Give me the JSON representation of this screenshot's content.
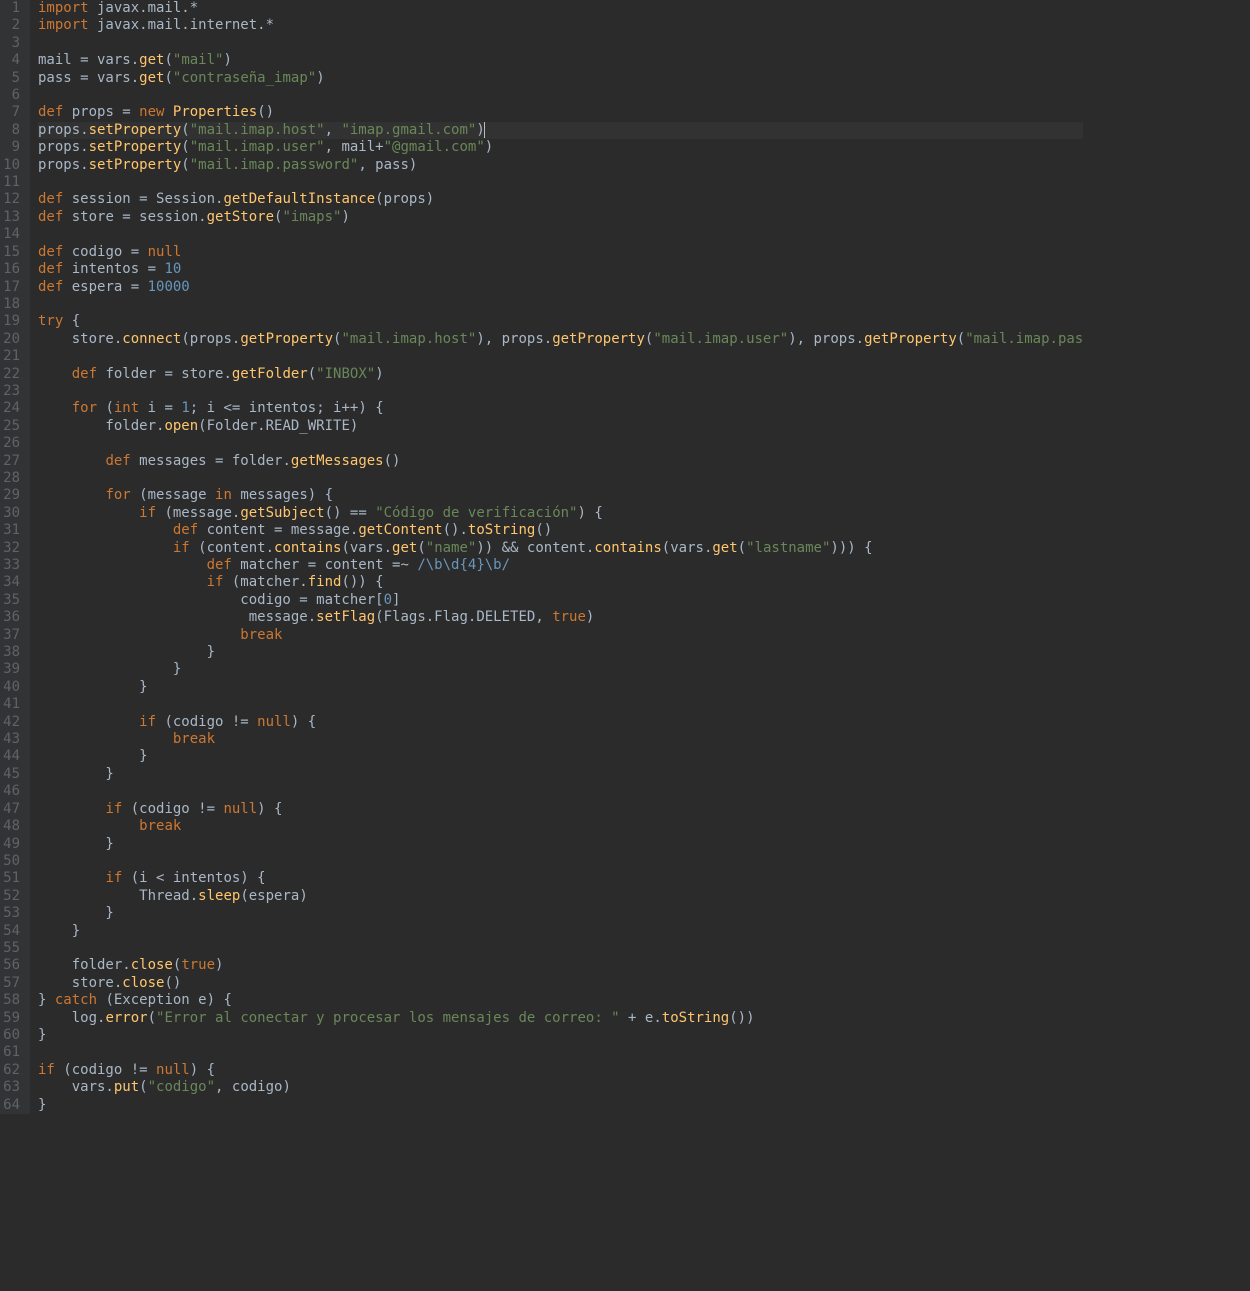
{
  "colors": {
    "bg": "#2b2b2b",
    "gutter": "#313335",
    "fg": "#a9b7c6",
    "kw": "#cc7832",
    "str": "#6a8759",
    "num": "#6897bb",
    "fn": "#ffc66d",
    "const": "#9876aa"
  },
  "highlighted_line": 8,
  "line_count": 64,
  "code_lines": [
    [
      [
        "kw",
        "import"
      ],
      [
        "id",
        " javax.mail.*"
      ]
    ],
    [
      [
        "kw",
        "import"
      ],
      [
        "id",
        " javax.mail.internet.*"
      ]
    ],
    [],
    [
      [
        "id",
        "mail = vars."
      ],
      [
        "fn",
        "get"
      ],
      [
        "id",
        "("
      ],
      [
        "str",
        "\"mail\""
      ],
      [
        "id",
        ")"
      ]
    ],
    [
      [
        "id",
        "pass = vars."
      ],
      [
        "fn",
        "get"
      ],
      [
        "id",
        "("
      ],
      [
        "str",
        "\"contraseña_imap\""
      ],
      [
        "id",
        ")"
      ]
    ],
    [],
    [
      [
        "kw",
        "def"
      ],
      [
        "id",
        " props = "
      ],
      [
        "kw",
        "new"
      ],
      [
        "id",
        " "
      ],
      [
        "fn",
        "Properties"
      ],
      [
        "id",
        "()"
      ]
    ],
    [
      [
        "id",
        "props."
      ],
      [
        "fn",
        "setProperty"
      ],
      [
        "id",
        "("
      ],
      [
        "str",
        "\"mail.imap.host\""
      ],
      [
        "id",
        ", "
      ],
      [
        "str",
        "\"imap.gmail.com\""
      ],
      [
        "id",
        ")"
      ],
      [
        "caret",
        ""
      ]
    ],
    [
      [
        "id",
        "props."
      ],
      [
        "fn",
        "setProperty"
      ],
      [
        "id",
        "("
      ],
      [
        "str",
        "\"mail.imap.user\""
      ],
      [
        "id",
        ", mail+"
      ],
      [
        "str",
        "\"@gmail.com\""
      ],
      [
        "id",
        ")"
      ]
    ],
    [
      [
        "id",
        "props."
      ],
      [
        "fn",
        "setProperty"
      ],
      [
        "id",
        "("
      ],
      [
        "str",
        "\"mail.imap.password\""
      ],
      [
        "id",
        ", pass)"
      ]
    ],
    [],
    [
      [
        "kw",
        "def"
      ],
      [
        "id",
        " session = Session."
      ],
      [
        "fn",
        "getDefaultInstance"
      ],
      [
        "id",
        "(props)"
      ]
    ],
    [
      [
        "kw",
        "def"
      ],
      [
        "id",
        " store = session."
      ],
      [
        "fn",
        "getStore"
      ],
      [
        "id",
        "("
      ],
      [
        "str",
        "\"imaps\""
      ],
      [
        "id",
        ")"
      ]
    ],
    [],
    [
      [
        "kw",
        "def"
      ],
      [
        "id",
        " codigo = "
      ],
      [
        "kw",
        "null"
      ]
    ],
    [
      [
        "kw",
        "def"
      ],
      [
        "id",
        " intentos = "
      ],
      [
        "num",
        "10"
      ]
    ],
    [
      [
        "kw",
        "def"
      ],
      [
        "id",
        " espera = "
      ],
      [
        "num",
        "10000"
      ]
    ],
    [],
    [
      [
        "kw",
        "try"
      ],
      [
        "id",
        " {"
      ]
    ],
    [
      [
        "id",
        "    store."
      ],
      [
        "fn",
        "connect"
      ],
      [
        "id",
        "(props."
      ],
      [
        "fn",
        "getProperty"
      ],
      [
        "id",
        "("
      ],
      [
        "str",
        "\"mail.imap.host\""
      ],
      [
        "id",
        "), props."
      ],
      [
        "fn",
        "getProperty"
      ],
      [
        "id",
        "("
      ],
      [
        "str",
        "\"mail.imap.user\""
      ],
      [
        "id",
        "), props."
      ],
      [
        "fn",
        "getProperty"
      ],
      [
        "id",
        "("
      ],
      [
        "str",
        "\"mail.imap.password\""
      ],
      [
        "id",
        "))"
      ]
    ],
    [],
    [
      [
        "id",
        "    "
      ],
      [
        "kw",
        "def"
      ],
      [
        "id",
        " folder = store."
      ],
      [
        "fn",
        "getFolder"
      ],
      [
        "id",
        "("
      ],
      [
        "str",
        "\"INBOX\""
      ],
      [
        "id",
        ")"
      ]
    ],
    [],
    [
      [
        "id",
        "    "
      ],
      [
        "kw",
        "for"
      ],
      [
        "id",
        " ("
      ],
      [
        "kw",
        "int"
      ],
      [
        "id",
        " i = "
      ],
      [
        "num",
        "1"
      ],
      [
        "id",
        "; i <= intentos; i++) {"
      ]
    ],
    [
      [
        "id",
        "        folder."
      ],
      [
        "fn",
        "open"
      ],
      [
        "id",
        "(Folder.READ_WRITE)"
      ]
    ],
    [],
    [
      [
        "id",
        "        "
      ],
      [
        "kw",
        "def"
      ],
      [
        "id",
        " messages = folder."
      ],
      [
        "fn",
        "getMessages"
      ],
      [
        "id",
        "()"
      ]
    ],
    [],
    [
      [
        "id",
        "        "
      ],
      [
        "kw",
        "for"
      ],
      [
        "id",
        " (message "
      ],
      [
        "kw",
        "in"
      ],
      [
        "id",
        " messages) {"
      ]
    ],
    [
      [
        "id",
        "            "
      ],
      [
        "kw",
        "if"
      ],
      [
        "id",
        " (message."
      ],
      [
        "fn",
        "getSubject"
      ],
      [
        "id",
        "() == "
      ],
      [
        "str",
        "\"Código de verificación\""
      ],
      [
        "id",
        ") {"
      ]
    ],
    [
      [
        "id",
        "                "
      ],
      [
        "kw",
        "def"
      ],
      [
        "id",
        " content = message."
      ],
      [
        "fn",
        "getContent"
      ],
      [
        "id",
        "()."
      ],
      [
        "fn",
        "toString"
      ],
      [
        "id",
        "()"
      ]
    ],
    [
      [
        "id",
        "                "
      ],
      [
        "kw",
        "if"
      ],
      [
        "id",
        " (content."
      ],
      [
        "fn",
        "contains"
      ],
      [
        "id",
        "(vars."
      ],
      [
        "fn",
        "get"
      ],
      [
        "id",
        "("
      ],
      [
        "str",
        "\"name\""
      ],
      [
        "id",
        ")) && content."
      ],
      [
        "fn",
        "contains"
      ],
      [
        "id",
        "(vars."
      ],
      [
        "fn",
        "get"
      ],
      [
        "id",
        "("
      ],
      [
        "str",
        "\"lastname\""
      ],
      [
        "id",
        "))) {"
      ]
    ],
    [
      [
        "id",
        "                    "
      ],
      [
        "kw",
        "def"
      ],
      [
        "id",
        " matcher = content =~ "
      ],
      [
        "rgx",
        "/\\b\\d{4}\\b/"
      ]
    ],
    [
      [
        "id",
        "                    "
      ],
      [
        "kw",
        "if"
      ],
      [
        "id",
        " (matcher."
      ],
      [
        "fn",
        "find"
      ],
      [
        "id",
        "()) {"
      ]
    ],
    [
      [
        "id",
        "                        codigo = matcher["
      ],
      [
        "num",
        "0"
      ],
      [
        "id",
        "]"
      ]
    ],
    [
      [
        "id",
        "                         message."
      ],
      [
        "fn",
        "setFlag"
      ],
      [
        "id",
        "(Flags.Flag.DELETED, "
      ],
      [
        "kw",
        "true"
      ],
      [
        "id",
        ")"
      ]
    ],
    [
      [
        "id",
        "                        "
      ],
      [
        "kw",
        "break"
      ]
    ],
    [
      [
        "id",
        "                    }"
      ]
    ],
    [
      [
        "id",
        "                }"
      ]
    ],
    [
      [
        "id",
        "            }"
      ]
    ],
    [],
    [
      [
        "id",
        "            "
      ],
      [
        "kw",
        "if"
      ],
      [
        "id",
        " (codigo != "
      ],
      [
        "kw",
        "null"
      ],
      [
        "id",
        ") {"
      ]
    ],
    [
      [
        "id",
        "                "
      ],
      [
        "kw",
        "break"
      ]
    ],
    [
      [
        "id",
        "            }"
      ]
    ],
    [
      [
        "id",
        "        }"
      ]
    ],
    [],
    [
      [
        "id",
        "        "
      ],
      [
        "kw",
        "if"
      ],
      [
        "id",
        " (codigo != "
      ],
      [
        "kw",
        "null"
      ],
      [
        "id",
        ") {"
      ]
    ],
    [
      [
        "id",
        "            "
      ],
      [
        "kw",
        "break"
      ]
    ],
    [
      [
        "id",
        "        }"
      ]
    ],
    [],
    [
      [
        "id",
        "        "
      ],
      [
        "kw",
        "if"
      ],
      [
        "id",
        " (i < intentos) {"
      ]
    ],
    [
      [
        "id",
        "            Thread."
      ],
      [
        "fn",
        "sleep"
      ],
      [
        "id",
        "(espera)"
      ]
    ],
    [
      [
        "id",
        "        }"
      ]
    ],
    [
      [
        "id",
        "    }"
      ]
    ],
    [],
    [
      [
        "id",
        "    folder."
      ],
      [
        "fn",
        "close"
      ],
      [
        "id",
        "("
      ],
      [
        "kw",
        "true"
      ],
      [
        "id",
        ")"
      ]
    ],
    [
      [
        "id",
        "    store."
      ],
      [
        "fn",
        "close"
      ],
      [
        "id",
        "()"
      ]
    ],
    [
      [
        "id",
        "} "
      ],
      [
        "kw",
        "catch"
      ],
      [
        "id",
        " (Exception e) {"
      ]
    ],
    [
      [
        "id",
        "    log."
      ],
      [
        "fn",
        "error"
      ],
      [
        "id",
        "("
      ],
      [
        "str",
        "\"Error al conectar y procesar los mensajes de correo: \""
      ],
      [
        "id",
        " + e."
      ],
      [
        "fn",
        "toString"
      ],
      [
        "id",
        "())"
      ]
    ],
    [
      [
        "id",
        "}"
      ]
    ],
    [],
    [
      [
        "kw",
        "if"
      ],
      [
        "id",
        " (codigo != "
      ],
      [
        "kw",
        "null"
      ],
      [
        "id",
        ") {"
      ]
    ],
    [
      [
        "id",
        "    vars."
      ],
      [
        "fn",
        "put"
      ],
      [
        "id",
        "("
      ],
      [
        "str",
        "\"codigo\""
      ],
      [
        "id",
        ", codigo)"
      ]
    ],
    [
      [
        "id",
        "}"
      ]
    ]
  ]
}
